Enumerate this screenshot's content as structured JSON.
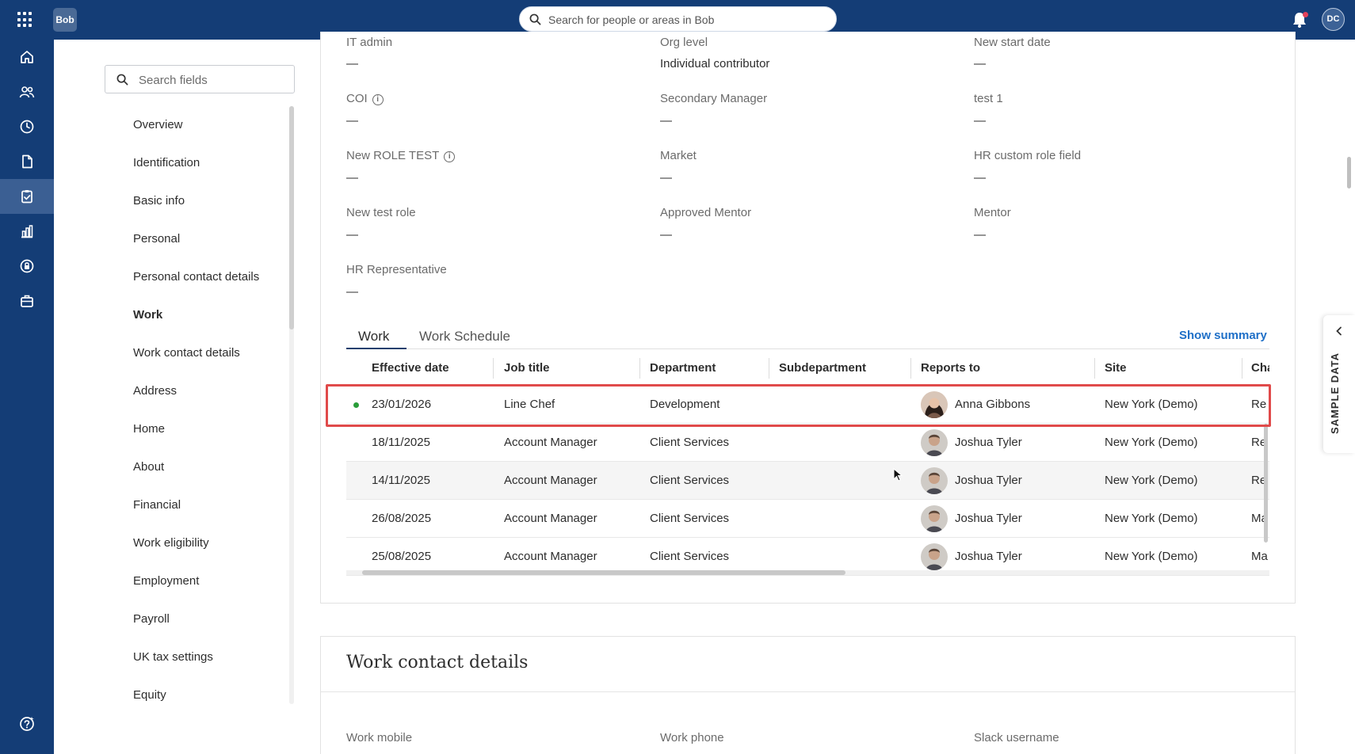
{
  "topbar": {
    "logo_text": "Bob",
    "search_placeholder": "Search for people or areas in Bob",
    "avatar_initials": "DC"
  },
  "rail": {
    "icons": [
      "home-icon",
      "people-icon",
      "time-icon",
      "documents-icon",
      "tasks-icon",
      "analytics-icon",
      "security-icon",
      "briefcase-icon",
      "help-icon"
    ],
    "active_index": 4
  },
  "sidebar": {
    "search_placeholder": "Search fields",
    "items": [
      {
        "label": "Overview"
      },
      {
        "label": "Identification"
      },
      {
        "label": "Basic info"
      },
      {
        "label": "Personal"
      },
      {
        "label": "Personal contact details"
      },
      {
        "label": "Work"
      },
      {
        "label": "Work contact details"
      },
      {
        "label": "Address"
      },
      {
        "label": "Home"
      },
      {
        "label": "About"
      },
      {
        "label": "Financial"
      },
      {
        "label": "Work eligibility"
      },
      {
        "label": "Employment"
      },
      {
        "label": "Payroll"
      },
      {
        "label": "UK tax settings"
      },
      {
        "label": "Equity"
      }
    ],
    "active": "Work"
  },
  "work": {
    "fields": [
      {
        "label": "IT admin",
        "value": "—"
      },
      {
        "label": "Org level",
        "value": "Individual contributor"
      },
      {
        "label": "New start date",
        "value": "—"
      },
      {
        "label": "COI",
        "value": "—",
        "info": true
      },
      {
        "label": "Secondary Manager",
        "value": "—"
      },
      {
        "label": "test 1",
        "value": "—"
      },
      {
        "label": "New ROLE TEST",
        "value": "—",
        "info": true
      },
      {
        "label": "Market",
        "value": "—"
      },
      {
        "label": "HR custom role field",
        "value": "—"
      },
      {
        "label": "New test role",
        "value": "—"
      },
      {
        "label": "Approved Mentor",
        "value": "—"
      },
      {
        "label": "Mentor",
        "value": "—"
      },
      {
        "label": "HR Representative",
        "value": "—"
      }
    ],
    "tabs": [
      "Work",
      "Work Schedule"
    ],
    "active_tab": "Work",
    "show_summary": "Show summary",
    "table": {
      "columns": [
        "Effective date",
        "Job title",
        "Department",
        "Subdepartment",
        "Reports to",
        "Site",
        "Cha"
      ],
      "rows": [
        {
          "date": "23/01/2026",
          "job": "Line Chef",
          "dept": "Development",
          "sub": "",
          "reports": "Anna Gibbons",
          "site": "New York (Demo)",
          "change": "Re",
          "current": true
        },
        {
          "date": "18/11/2025",
          "job": "Account Manager",
          "dept": "Client Services",
          "sub": "",
          "reports": "Joshua Tyler",
          "site": "New York (Demo)",
          "change": "Re",
          "current": false
        },
        {
          "date": "14/11/2025",
          "job": "Account Manager",
          "dept": "Client Services",
          "sub": "",
          "reports": "Joshua Tyler",
          "site": "New York (Demo)",
          "change": "Re",
          "current": false
        },
        {
          "date": "26/08/2025",
          "job": "Account Manager",
          "dept": "Client Services",
          "sub": "",
          "reports": "Joshua Tyler",
          "site": "New York (Demo)",
          "change": "Ma",
          "current": false
        },
        {
          "date": "25/08/2025",
          "job": "Account Manager",
          "dept": "Client Services",
          "sub": "",
          "reports": "Joshua Tyler",
          "site": "New York (Demo)",
          "change": "Ma",
          "current": false
        }
      ]
    }
  },
  "work_contact": {
    "title": "Work contact details",
    "fields": [
      {
        "label": "Work mobile"
      },
      {
        "label": "Work phone"
      },
      {
        "label": "Slack username"
      }
    ]
  },
  "sample_tab": {
    "label": "SAMPLE DATA"
  },
  "colors": {
    "topbar": "#143d76",
    "active_rail": "#3b5f93",
    "link": "#1e6fc7",
    "highlight": "#e04a4a",
    "current_dot": "#2a9d3a"
  }
}
